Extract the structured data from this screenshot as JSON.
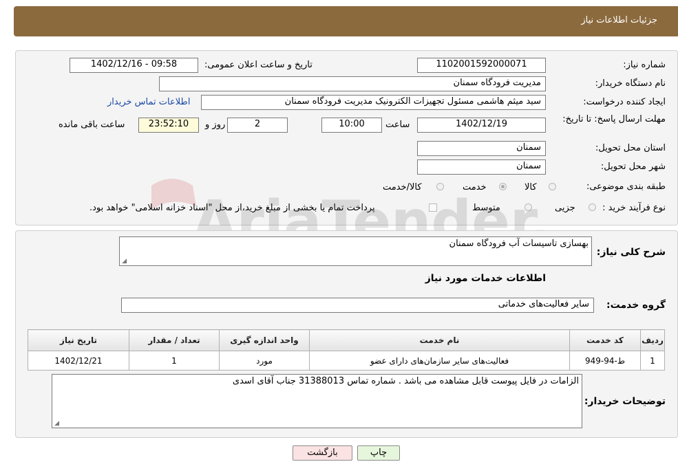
{
  "header": {
    "title": "جزئیات اطلاعات نیاز"
  },
  "form": {
    "need_number": {
      "label": "شماره نیاز:",
      "value": "1102001592000071"
    },
    "announce_datetime": {
      "label": "تاریخ و ساعت اعلان عمومی:",
      "value": "1402/12/16 - 09:58"
    },
    "buyer_org": {
      "label": "نام دستگاه خریدار:",
      "value": "مدیریت فرودگاه سمنان"
    },
    "requester": {
      "label": "ایجاد کننده درخواست:",
      "value": "سید میثم هاشمی مسئول تجهیزات الکترونیک مدیریت فرودگاه سمنان"
    },
    "buyer_contact_link": "اطلاعات تماس خریدار",
    "deadline": {
      "label": "مهلت ارسال پاسخ: تا تاریخ:",
      "date": "1402/12/19",
      "time_label": "ساعت",
      "time": "10:00",
      "days": "2",
      "days_label": "روز و",
      "remaining": "23:52:10",
      "remaining_label": "ساعت باقی مانده"
    },
    "delivery_province": {
      "label": "استان محل تحویل:",
      "value": "سمنان"
    },
    "delivery_city": {
      "label": "شهر محل تحویل:",
      "value": "سمنان"
    },
    "subject_category": {
      "label": "طبقه بندی موضوعی:",
      "options": [
        "کالا",
        "خدمت",
        "کالا/خدمت"
      ],
      "selected": "خدمت"
    },
    "purchase_process": {
      "label": "نوع فرآیند خرید :",
      "options": [
        "جزیی",
        "متوسط"
      ],
      "note": "پرداخت تمام یا بخشی از مبلغ خرید،از محل \"اسناد خزانه اسلامی\" خواهد بود."
    }
  },
  "details": {
    "description_label": "شرح کلی نیاز:",
    "description_value": "بهسازی تاسیسات آب فرودگاه سمنان",
    "services_heading": "اطلاعات خدمات مورد نیاز",
    "service_group_label": "گروه خدمت:",
    "service_group_value": "سایر فعالیت‌های خدماتی",
    "table": {
      "headers": [
        "ردیف",
        "کد خدمت",
        "نام خدمت",
        "واحد اندازه گیری",
        "تعداد / مقدار",
        "تاریخ نیاز"
      ],
      "rows": [
        [
          "1",
          "ط-94-949",
          "فعالیت‌های سایر سازمان‌های دارای عضو",
          "مورد",
          "1",
          "1402/12/21"
        ]
      ]
    },
    "buyer_notes_label": "توضیحات خریدار:",
    "buyer_notes_value": "الزامات در فایل پیوست قابل مشاهده می باشد . شماره تماس 31388013 جناب آقای اسدی"
  },
  "buttons": {
    "print": "چاپ",
    "back": "بازگشت"
  },
  "watermark": "AriaTender.neT",
  "colors": {
    "header_bg": "#8b6a3e",
    "link": "#1a49a6",
    "print_btn": "#e6f6dc",
    "back_btn": "#fbe3e3"
  }
}
